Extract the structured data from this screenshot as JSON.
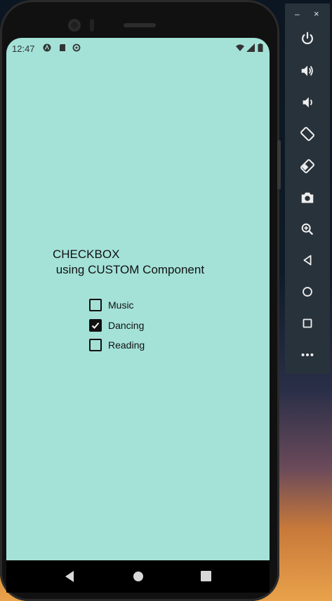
{
  "status_bar": {
    "time": "12:47"
  },
  "heading": {
    "line1": "CHECKBOX",
    "line2": " using CUSTOM Component"
  },
  "checkboxes": [
    {
      "label": "Music",
      "checked": false
    },
    {
      "label": "Dancing",
      "checked": true
    },
    {
      "label": "Reading",
      "checked": false
    }
  ],
  "colors": {
    "screen_bg": "#a4e2d8",
    "toolbar_bg": "#28323b"
  },
  "emulator_toolbar": {
    "minimize": "–",
    "close": "×",
    "buttons": [
      "power-icon",
      "volume-up-icon",
      "volume-down-icon",
      "rotate-left-icon",
      "rotate-right-icon",
      "camera-icon",
      "zoom-icon",
      "back-icon",
      "home-icon",
      "overview-icon",
      "more-icon"
    ]
  }
}
